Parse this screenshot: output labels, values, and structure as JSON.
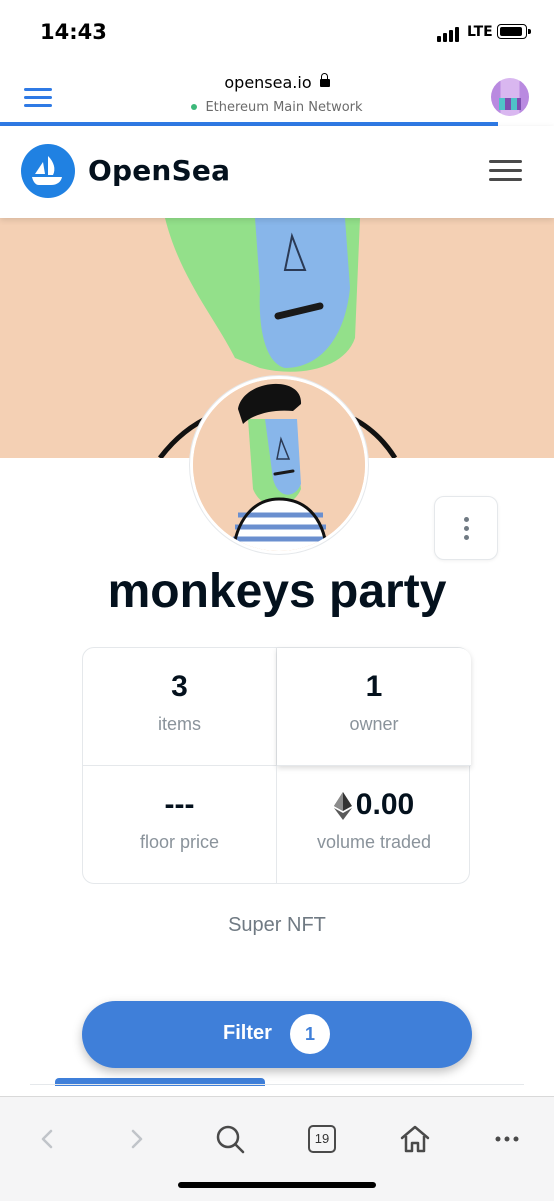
{
  "status_bar": {
    "time": "14:43",
    "network": "LTE"
  },
  "browser": {
    "host": "opensea.io",
    "network_label": "Ethereum Main Network",
    "tab_count": "19"
  },
  "header": {
    "brand": "OpenSea"
  },
  "collection": {
    "name": "monkeys party",
    "description": "Super NFT",
    "stats": {
      "items_value": "3",
      "items_label": "items",
      "owners_value": "1",
      "owners_label": "owner",
      "floor_value": "---",
      "floor_label": "floor price",
      "volume_value": "0.00",
      "volume_label": "volume traded"
    }
  },
  "filter": {
    "label": "Filter",
    "count": "1"
  },
  "colors": {
    "accent": "#2081e2",
    "filter_button": "#3f7fd9",
    "banner_bg": "#f4d0b4",
    "text_primary": "#04111d",
    "text_secondary": "#8a939b"
  },
  "icons": [
    "menu-icon",
    "lock-icon",
    "opensea-logo-icon",
    "more-vertical-icon",
    "ethereum-icon",
    "back-icon",
    "forward-icon",
    "search-icon",
    "tabs-icon",
    "home-icon",
    "more-horizontal-icon"
  ]
}
